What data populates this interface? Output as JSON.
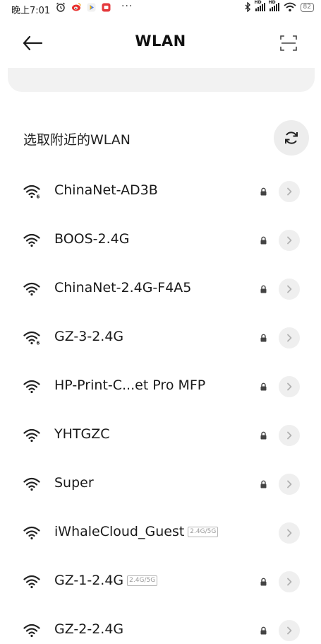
{
  "status_bar": {
    "time": "晚上7:01",
    "more": "···",
    "battery": "82",
    "hd1": "HD",
    "hd2": "HD",
    "icons": [
      "alarm-icon",
      "weibo-icon",
      "play-icon",
      "red-app-icon",
      "bluetooth-icon",
      "signal-icon",
      "signal-icon",
      "wifi-icon",
      "battery-icon"
    ]
  },
  "header": {
    "title": "WLAN",
    "back_icon": "back-arrow-icon",
    "scan_icon": "scan-icon"
  },
  "section": {
    "title": "选取附近的WLAN",
    "refresh_icon": "refresh-icon"
  },
  "networks": [
    {
      "name": "ChinaNet-AD3B",
      "badge": "",
      "locked": true,
      "wifi6": true
    },
    {
      "name": "BOOS-2.4G",
      "badge": "",
      "locked": true,
      "wifi6": false
    },
    {
      "name": "ChinaNet-2.4G-F4A5",
      "badge": "",
      "locked": true,
      "wifi6": false
    },
    {
      "name": "GZ-3-2.4G",
      "badge": "",
      "locked": true,
      "wifi6": true
    },
    {
      "name": "HP-Print-C...et Pro MFP",
      "badge": "",
      "locked": true,
      "wifi6": false
    },
    {
      "name": "YHTGZC",
      "badge": "",
      "locked": true,
      "wifi6": false
    },
    {
      "name": "Super",
      "badge": "",
      "locked": true,
      "wifi6": false
    },
    {
      "name": "iWhaleCloud_Guest",
      "badge": "2.4G/5G",
      "locked": false,
      "wifi6": false
    },
    {
      "name": "GZ-1-2.4G",
      "badge": "2.4G/5G",
      "locked": true,
      "wifi6": false
    },
    {
      "name": "GZ-2-2.4G",
      "badge": "",
      "locked": true,
      "wifi6": false
    }
  ],
  "colors": {
    "background": "#ffffff",
    "text": "#1a1a1a",
    "chip": "#efefef",
    "icon": "#222222",
    "badge": "#9a9a9a"
  }
}
